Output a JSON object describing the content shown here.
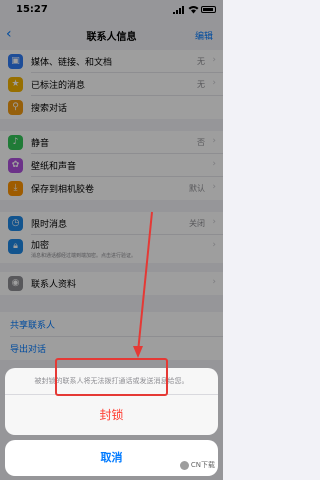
{
  "status_bar": {
    "time": "15:27"
  },
  "nav": {
    "back": "‹",
    "title": "联系人信息",
    "edit": "编辑"
  },
  "group1": [
    {
      "label": "媒体、链接、和文档",
      "value": "无",
      "icon": "photos-icon",
      "color": "#2f7cf6"
    },
    {
      "label": "已标注的消息",
      "value": "无",
      "icon": "star-icon",
      "color": "#f4b400"
    },
    {
      "label": "搜索对话",
      "value": "",
      "icon": "search-icon",
      "color": "#f39c12"
    }
  ],
  "group2": [
    {
      "label": "静音",
      "value": "否",
      "icon": "mute-icon",
      "color": "#34c759"
    },
    {
      "label": "壁纸和声音",
      "value": "",
      "icon": "wallpaper-icon",
      "color": "#af52de"
    },
    {
      "label": "保存到相机胶卷",
      "value": "默认",
      "icon": "save-icon",
      "color": "#ff9500"
    }
  ],
  "group3": [
    {
      "label": "限时消息",
      "value": "关闭",
      "icon": "timer-icon",
      "color": "#1e88e5"
    },
    {
      "label": "加密",
      "value": "",
      "icon": "lock-icon",
      "color": "#1e88e5",
      "sub": "消息和通话都经过端到端加密。点击进行验证。"
    }
  ],
  "group4": [
    {
      "label": "联系人资料",
      "value": "",
      "icon": "contact-icon",
      "color": "#8e8e93"
    }
  ],
  "links": {
    "share": "共享联系人",
    "export": "导出对话"
  },
  "sheet": {
    "message": "被封锁的联系人将无法拨打通话或发送消息给您。",
    "block": "封锁",
    "cancel": "取消"
  },
  "watermark": "CN下载",
  "colors": {
    "accent": "#007aff",
    "destructive": "#ff3b30",
    "highlight": "#e53935"
  }
}
